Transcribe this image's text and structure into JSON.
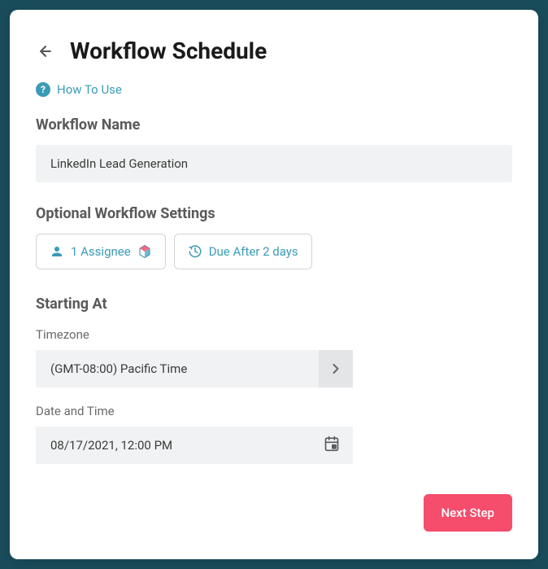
{
  "header": {
    "title": "Workflow Schedule"
  },
  "helpLink": {
    "label": "How To Use"
  },
  "workflowName": {
    "label": "Workflow Name",
    "value": "LinkedIn Lead Generation"
  },
  "optionalSettings": {
    "label": "Optional Workflow Settings",
    "assigneeChip": "1 Assignee",
    "dueChip": "Due After 2 days"
  },
  "startingAt": {
    "label": "Starting At",
    "timezoneLabel": "Timezone",
    "timezoneValue": "(GMT-08:00) Pacific Time",
    "dateTimeLabel": "Date and Time",
    "dateTimeValue": "08/17/2021, 12:00 PM"
  },
  "footer": {
    "nextButton": "Next Step"
  }
}
